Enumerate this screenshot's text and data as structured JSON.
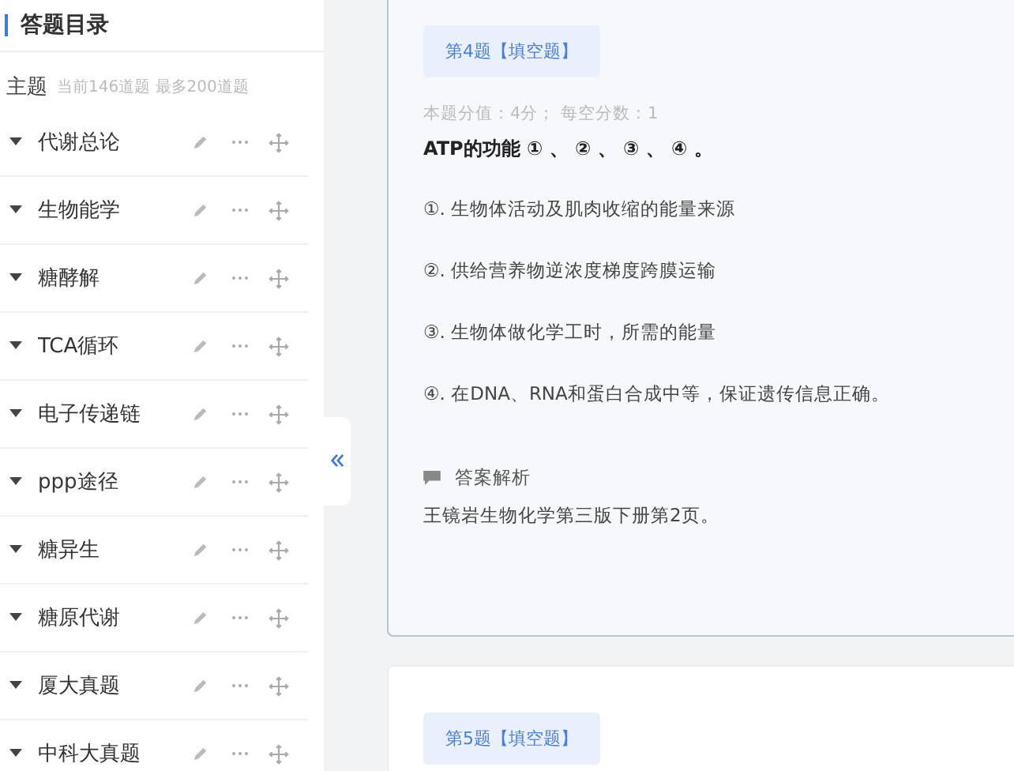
{
  "sidebar": {
    "title": "答题目录",
    "topic_label": "主题",
    "topic_hint": "当前146道题 最多200道题",
    "items": [
      {
        "label": "代谢总论",
        "expanded": true
      },
      {
        "label": "生物能学",
        "expanded": true
      },
      {
        "label": "糖酵解",
        "expanded": true
      },
      {
        "label": "TCA循环",
        "expanded": true
      },
      {
        "label": "电子传递链",
        "expanded": true
      },
      {
        "label": "ppp途径",
        "expanded": true
      },
      {
        "label": "糖异生",
        "expanded": true
      },
      {
        "label": "糖原代谢",
        "expanded": true
      },
      {
        "label": "厦大真题",
        "expanded": true
      },
      {
        "label": "中科大真题",
        "expanded": true
      }
    ]
  },
  "questions": [
    {
      "tag": "第4题【填空题】",
      "selected": true,
      "score": "本题分值：4分；  每空分数：1",
      "stem": "ATP的功能 ① 、 ② 、 ③ 、 ④ 。",
      "answers": [
        "①. 生物体活动及肌肉收缩的能量来源",
        "②. 供给营养物逆浓度梯度跨膜运输",
        "③. 生物体做化学工时，所需的能量",
        "④. 在DNA、RNA和蛋白合成中等，保证遗传信息正确。"
      ],
      "analysis_label": "答案解析",
      "analysis": "王镜岩生物化学第三版下册第2页。"
    },
    {
      "tag": "第5题【填空题】",
      "selected": false
    }
  ]
}
